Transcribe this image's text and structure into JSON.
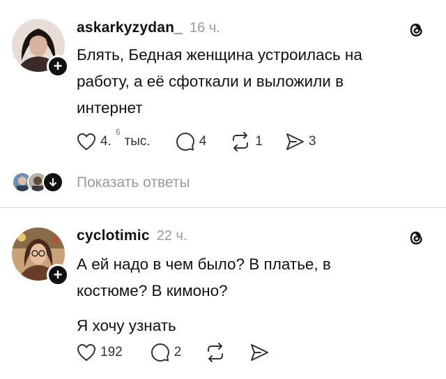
{
  "posts": [
    {
      "username": "askarkyzydan_",
      "time": "16 ч.",
      "lines": [
        "Блять, Бедная женщина устроилась на",
        "работу, а её сфоткали и выложили в",
        "интернет"
      ],
      "likes": "4.",
      "likes_sup": "6",
      "likes_unit": "тыс.",
      "comments": "4",
      "reposts": "1",
      "shares": "3",
      "show_replies": "Показать ответы"
    },
    {
      "username": "cyclotimic",
      "time": "22 ч.",
      "lines": [
        "А ей надо в чем было? В платье, в",
        "костюме? В кимоно?"
      ],
      "extra_line": "Я хочу узнать",
      "likes": "192",
      "comments": "2"
    }
  ],
  "icons": {
    "heart": "heart-icon",
    "comment": "comment-icon",
    "repost": "repost-icon",
    "share": "send-icon",
    "logo": "threads-logo"
  },
  "colors": {
    "text": "#111111",
    "muted": "#9a9a9a",
    "divider": "#d6d6d6"
  }
}
